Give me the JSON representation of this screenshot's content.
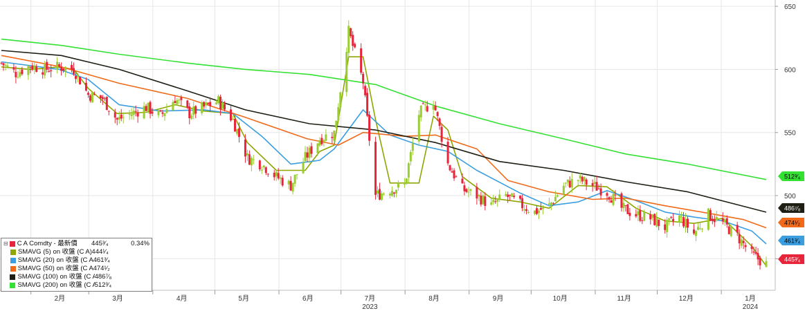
{
  "chart_data": {
    "type": "line",
    "title": "",
    "xlabel": "",
    "ylabel": "",
    "ylim": [
      425,
      655
    ],
    "yticks": [
      450,
      500,
      550,
      600,
      650
    ],
    "x_ticks": [
      {
        "label": "2月",
        "year": ""
      },
      {
        "label": "3月",
        "year": ""
      },
      {
        "label": "4月",
        "year": ""
      },
      {
        "label": "5月",
        "year": ""
      },
      {
        "label": "6月",
        "year": ""
      },
      {
        "label": "7月",
        "year": "2023"
      },
      {
        "label": "8月",
        "year": ""
      },
      {
        "label": "9月",
        "year": ""
      },
      {
        "label": "10月",
        "year": ""
      },
      {
        "label": "11月",
        "year": ""
      },
      {
        "label": "12月",
        "year": ""
      },
      {
        "label": "1月",
        "year": "2024"
      }
    ],
    "grid": true,
    "legend_position": "bottom-left",
    "x_range": [
      "2023-01-03",
      "2024-01-08"
    ],
    "series": [
      {
        "name": "C A Comdty - 最新價",
        "type": "candlestick",
        "up_color": "#9acd32",
        "down_color": "#e8243a",
        "value_label": "445³⁄₄",
        "change_label": "0.34%",
        "ohlc_note": "daily candles",
        "closes": [
          [
            "2023-01-03",
            605
          ],
          [
            "2023-01-10",
            597
          ],
          [
            "2023-01-17",
            603
          ],
          [
            "2023-01-24",
            600
          ],
          [
            "2023-01-31",
            602
          ],
          [
            "2023-02-07",
            600
          ],
          [
            "2023-02-14",
            580
          ],
          [
            "2023-02-21",
            577
          ],
          [
            "2023-02-28",
            560
          ],
          [
            "2023-03-07",
            565
          ],
          [
            "2023-03-14",
            570
          ],
          [
            "2023-03-21",
            563
          ],
          [
            "2023-03-28",
            577
          ],
          [
            "2023-04-04",
            565
          ],
          [
            "2023-04-11",
            570
          ],
          [
            "2023-04-18",
            575
          ],
          [
            "2023-04-25",
            560
          ],
          [
            "2023-05-02",
            530
          ],
          [
            "2023-05-09",
            525
          ],
          [
            "2023-05-16",
            515
          ],
          [
            "2023-05-23",
            508
          ],
          [
            "2023-05-30",
            530
          ],
          [
            "2023-06-06",
            545
          ],
          [
            "2023-06-13",
            550
          ],
          [
            "2023-06-20",
            630
          ],
          [
            "2023-06-27",
            590
          ],
          [
            "2023-07-03",
            500
          ],
          [
            "2023-07-10",
            505
          ],
          [
            "2023-07-17",
            508
          ],
          [
            "2023-07-24",
            565
          ],
          [
            "2023-07-31",
            575
          ],
          [
            "2023-08-07",
            525
          ],
          [
            "2023-08-14",
            505
          ],
          [
            "2023-08-21",
            500
          ],
          [
            "2023-08-28",
            492
          ],
          [
            "2023-09-04",
            500
          ],
          [
            "2023-09-11",
            493
          ],
          [
            "2023-09-18",
            487
          ],
          [
            "2023-09-25",
            492
          ],
          [
            "2023-10-02",
            508
          ],
          [
            "2023-10-09",
            513
          ],
          [
            "2023-10-16",
            508
          ],
          [
            "2023-10-23",
            503
          ],
          [
            "2023-10-30",
            490
          ],
          [
            "2023-11-06",
            485
          ],
          [
            "2023-11-13",
            482
          ],
          [
            "2023-11-20",
            475
          ],
          [
            "2023-11-27",
            483
          ],
          [
            "2023-12-04",
            470
          ],
          [
            "2023-12-11",
            485
          ],
          [
            "2023-12-18",
            478
          ],
          [
            "2023-12-25",
            468
          ],
          [
            "2024-01-01",
            453
          ],
          [
            "2024-01-08",
            445.75
          ]
        ]
      },
      {
        "name": "SMAVG (5)  on 收盤 (C A)",
        "color": "#8fa600",
        "value_label": "444¹⁄₄",
        "points": [
          [
            "2023-01-03",
            602
          ],
          [
            "2023-01-17",
            600
          ],
          [
            "2023-01-31",
            602
          ],
          [
            "2023-02-07",
            600
          ],
          [
            "2023-02-14",
            585
          ],
          [
            "2023-02-28",
            565
          ],
          [
            "2023-03-14",
            566
          ],
          [
            "2023-03-28",
            572
          ],
          [
            "2023-04-11",
            567
          ],
          [
            "2023-04-25",
            565
          ],
          [
            "2023-05-02",
            542
          ],
          [
            "2023-05-16",
            520
          ],
          [
            "2023-05-30",
            520
          ],
          [
            "2023-06-06",
            535
          ],
          [
            "2023-06-13",
            540
          ],
          [
            "2023-06-20",
            610
          ],
          [
            "2023-06-27",
            610
          ],
          [
            "2023-07-03",
            560
          ],
          [
            "2023-07-10",
            510
          ],
          [
            "2023-07-24",
            510
          ],
          [
            "2023-07-31",
            563
          ],
          [
            "2023-08-07",
            552
          ],
          [
            "2023-08-14",
            515
          ],
          [
            "2023-08-28",
            498
          ],
          [
            "2023-09-11",
            495
          ],
          [
            "2023-09-25",
            490
          ],
          [
            "2023-10-09",
            508
          ],
          [
            "2023-10-23",
            507
          ],
          [
            "2023-11-06",
            490
          ],
          [
            "2023-11-20",
            480
          ],
          [
            "2023-12-04",
            478
          ],
          [
            "2023-12-18",
            482
          ],
          [
            "2024-01-01",
            460
          ],
          [
            "2024-01-08",
            444.25
          ]
        ]
      },
      {
        "name": "SMAVG (20)  on 收盤 (C A)",
        "color": "#3a9ee0",
        "value_label": "461³⁄₄",
        "points": [
          [
            "2023-01-03",
            606
          ],
          [
            "2023-01-31",
            600
          ],
          [
            "2023-02-14",
            592
          ],
          [
            "2023-03-01",
            572
          ],
          [
            "2023-03-21",
            567
          ],
          [
            "2023-04-11",
            568
          ],
          [
            "2023-04-25",
            565
          ],
          [
            "2023-05-09",
            547
          ],
          [
            "2023-05-23",
            525
          ],
          [
            "2023-06-06",
            528
          ],
          [
            "2023-06-13",
            537
          ],
          [
            "2023-06-27",
            568
          ],
          [
            "2023-07-10",
            548
          ],
          [
            "2023-07-24",
            540
          ],
          [
            "2023-08-07",
            535
          ],
          [
            "2023-08-21",
            520
          ],
          [
            "2023-09-11",
            502
          ],
          [
            "2023-09-25",
            492
          ],
          [
            "2023-10-09",
            495
          ],
          [
            "2023-10-23",
            504
          ],
          [
            "2023-11-06",
            496
          ],
          [
            "2023-11-20",
            487
          ],
          [
            "2023-12-04",
            483
          ],
          [
            "2023-12-18",
            480
          ],
          [
            "2024-01-01",
            472
          ],
          [
            "2024-01-08",
            461.75
          ]
        ]
      },
      {
        "name": "SMAVG (50)  on 收盤 (C A)",
        "color": "#f06a1a",
        "value_label": "474¹⁄₂",
        "points": [
          [
            "2023-01-03",
            611
          ],
          [
            "2023-02-01",
            602
          ],
          [
            "2023-03-01",
            589
          ],
          [
            "2023-04-03",
            577
          ],
          [
            "2023-05-01",
            562
          ],
          [
            "2023-05-31",
            545
          ],
          [
            "2023-06-15",
            540
          ],
          [
            "2023-06-27",
            550
          ],
          [
            "2023-07-17",
            547
          ],
          [
            "2023-08-01",
            548
          ],
          [
            "2023-08-21",
            537
          ],
          [
            "2023-09-05",
            512
          ],
          [
            "2023-09-25",
            503
          ],
          [
            "2023-10-16",
            497
          ],
          [
            "2023-11-01",
            498
          ],
          [
            "2023-11-20",
            492
          ],
          [
            "2023-12-11",
            486
          ],
          [
            "2023-12-28",
            481
          ],
          [
            "2024-01-08",
            474.5
          ]
        ]
      },
      {
        "name": "SMAVG (100)  on 收盤 (C A)",
        "color": "#1e1e14",
        "value_label": "486⁷⁄₈",
        "points": [
          [
            "2023-01-03",
            615
          ],
          [
            "2023-02-01",
            611
          ],
          [
            "2023-03-01",
            600
          ],
          [
            "2023-04-03",
            583
          ],
          [
            "2023-05-01",
            568
          ],
          [
            "2023-06-01",
            557
          ],
          [
            "2023-07-03",
            552
          ],
          [
            "2023-08-01",
            542
          ],
          [
            "2023-09-01",
            527
          ],
          [
            "2023-10-02",
            520
          ],
          [
            "2023-11-01",
            511
          ],
          [
            "2023-12-01",
            503
          ],
          [
            "2024-01-08",
            486.875
          ]
        ]
      },
      {
        "name": "SMAVG (200)  on 收盤 (C A)",
        "color": "#33e133",
        "value_label": "512³⁄₄",
        "points": [
          [
            "2023-01-03",
            624
          ],
          [
            "2023-02-01",
            619
          ],
          [
            "2023-03-01",
            612
          ],
          [
            "2023-04-03",
            605
          ],
          [
            "2023-05-01",
            600
          ],
          [
            "2023-06-01",
            596
          ],
          [
            "2023-07-03",
            588
          ],
          [
            "2023-08-01",
            571
          ],
          [
            "2023-09-01",
            557
          ],
          [
            "2023-10-02",
            545
          ],
          [
            "2023-11-01",
            533
          ],
          [
            "2023-12-01",
            525
          ],
          [
            "2024-01-08",
            512.75
          ]
        ]
      }
    ]
  }
}
